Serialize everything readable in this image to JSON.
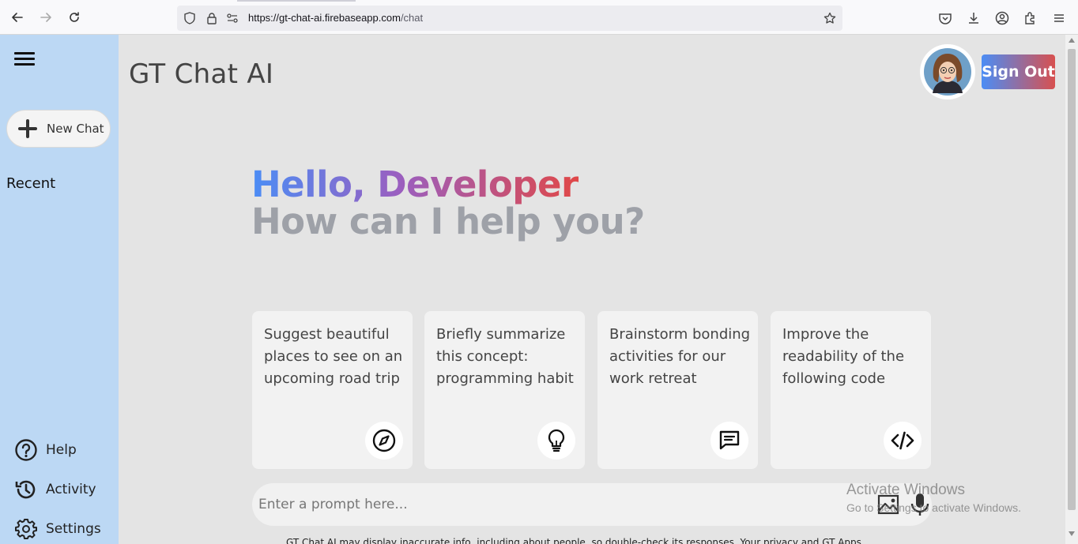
{
  "browser": {
    "url_host": "https://gt-chat-ai.firebaseapp.com",
    "url_path": "/chat"
  },
  "sidebar": {
    "new_chat_label": "New Chat",
    "recent_label": "Recent",
    "items": [
      {
        "label": "Help",
        "icon": "help-circle-icon"
      },
      {
        "label": "Activity",
        "icon": "history-icon"
      },
      {
        "label": "Settings",
        "icon": "gear-icon"
      }
    ]
  },
  "header": {
    "title": "GT Chat AI",
    "sign_out_label": "Sign Out"
  },
  "greeting": {
    "line1": "Hello, Developer",
    "line2": "How can I help you?"
  },
  "cards": [
    {
      "text": "Suggest beautiful places to see on an upcoming road trip",
      "icon": "compass-icon"
    },
    {
      "text": "Briefly summarize this concept: programming habit",
      "icon": "lightbulb-icon"
    },
    {
      "text": "Brainstorm bonding activities for our work retreat",
      "icon": "message-icon"
    },
    {
      "text": "Improve the readability of the following code",
      "icon": "code-icon"
    }
  ],
  "prompt": {
    "placeholder": "Enter a prompt here..."
  },
  "disclaimer": "GT Chat AI may display inaccurate info, including about people, so double-check its responses. Your privacy and GT Apps",
  "watermark": {
    "line1": "Activate Windows",
    "line2": "Go to Settings to activate Windows."
  },
  "colors": {
    "sidebar_bg": "#bcd8f4",
    "page_bg": "#e4e4e4",
    "gradient_start": "#4b8df5",
    "gradient_end": "#e04848"
  }
}
